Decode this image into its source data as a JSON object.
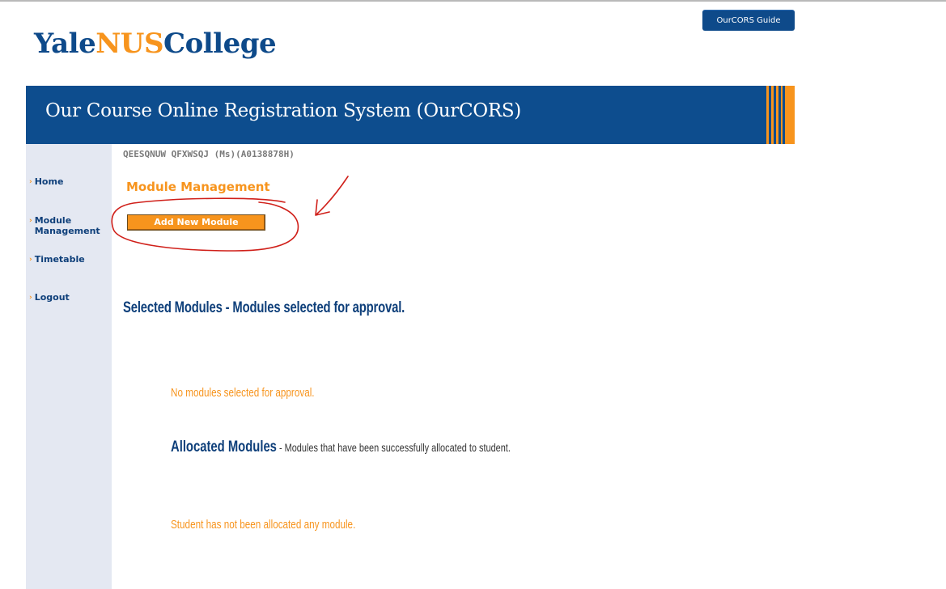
{
  "header": {
    "guide_button": "OurCORS Guide",
    "logo": {
      "part1": "Yale",
      "part2": "NUS",
      "part3": "College"
    },
    "banner_title": "Our Course Online Registration System (OurCORS)"
  },
  "sidebar": {
    "items": [
      {
        "label": "Home"
      },
      {
        "label": "Module Management"
      },
      {
        "label": "Timetable"
      },
      {
        "label": "Logout"
      }
    ]
  },
  "main": {
    "student_info": "QEESQNUW QFXWSQJ (Ms)(A0138878H)",
    "page_title": "Module Management",
    "add_button": "Add New Module",
    "selected_title": "Selected Modules - Modules selected for approval.",
    "selected_empty": "No modules selected for approval.",
    "allocated_title": "Allocated Modules",
    "allocated_desc": " - Modules that have been successfully allocated to student.",
    "allocated_empty": "Student has not been allocated any module."
  },
  "colors": {
    "brand_blue": "#0d4d8e",
    "accent_orange": "#f7941d",
    "sidebar_bg": "#e4e8f2",
    "annotation_red": "#d0201a"
  },
  "icons": {
    "nav_bullet": "chevron-right-icon"
  }
}
